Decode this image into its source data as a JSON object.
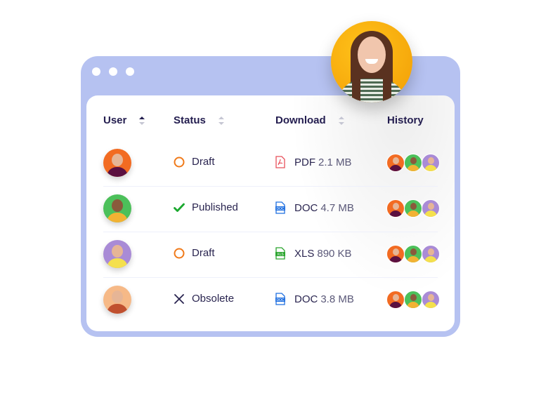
{
  "window": {
    "title_dots": [
      "close",
      "minimize",
      "maximize"
    ]
  },
  "table": {
    "columns": [
      {
        "label": "User",
        "sortable": true,
        "sort_state": "ascending"
      },
      {
        "label": "Status",
        "sortable": true,
        "sort_state": "none"
      },
      {
        "label": "Download",
        "sortable": true,
        "sort_state": "none"
      },
      {
        "label": "History",
        "sortable": false
      }
    ],
    "rows": [
      {
        "user_avatar": "man-beard-orange-bg",
        "status": "Draft",
        "status_icon": "circle-icon",
        "file_type": "PDF",
        "file_size": "2.1 MB",
        "file_icon": "pdf-file-icon",
        "history": [
          "man-beard-orange-bg",
          "woman-curly-green-bg",
          "woman-purple-bg"
        ]
      },
      {
        "user_avatar": "woman-curly-green-bg",
        "status": "Published",
        "status_icon": "check-icon",
        "file_type": "DOC",
        "file_size": "4.7 MB",
        "file_icon": "doc-file-icon",
        "history": [
          "man-beard-orange-bg",
          "woman-curly-green-bg",
          "woman-purple-bg"
        ]
      },
      {
        "user_avatar": "woman-purple-bg",
        "status": "Draft",
        "status_icon": "circle-icon",
        "file_type": "XLS",
        "file_size": "890 KB",
        "file_icon": "xls-file-icon",
        "history": [
          "man-beard-orange-bg",
          "woman-curly-green-bg",
          "woman-purple-bg"
        ]
      },
      {
        "user_avatar": "man-glasses-peach-bg",
        "status": "Obsolete",
        "status_icon": "x-icon",
        "file_type": "DOC",
        "file_size": "3.8 MB",
        "file_icon": "doc-file-icon",
        "history": [
          "man-beard-orange-bg",
          "woman-curly-green-bg",
          "woman-purple-bg"
        ]
      }
    ]
  },
  "floating_avatar": "woman-yellow-bg",
  "colors": {
    "window_frame": "#b6c2f1",
    "header_text": "#231d4f",
    "draft": "#f07a1a",
    "published": "#1aa82e",
    "obsolete": "#2a2550",
    "pdf": "#e8505b",
    "doc": "#1f6fe0",
    "xls": "#2aa52e"
  }
}
